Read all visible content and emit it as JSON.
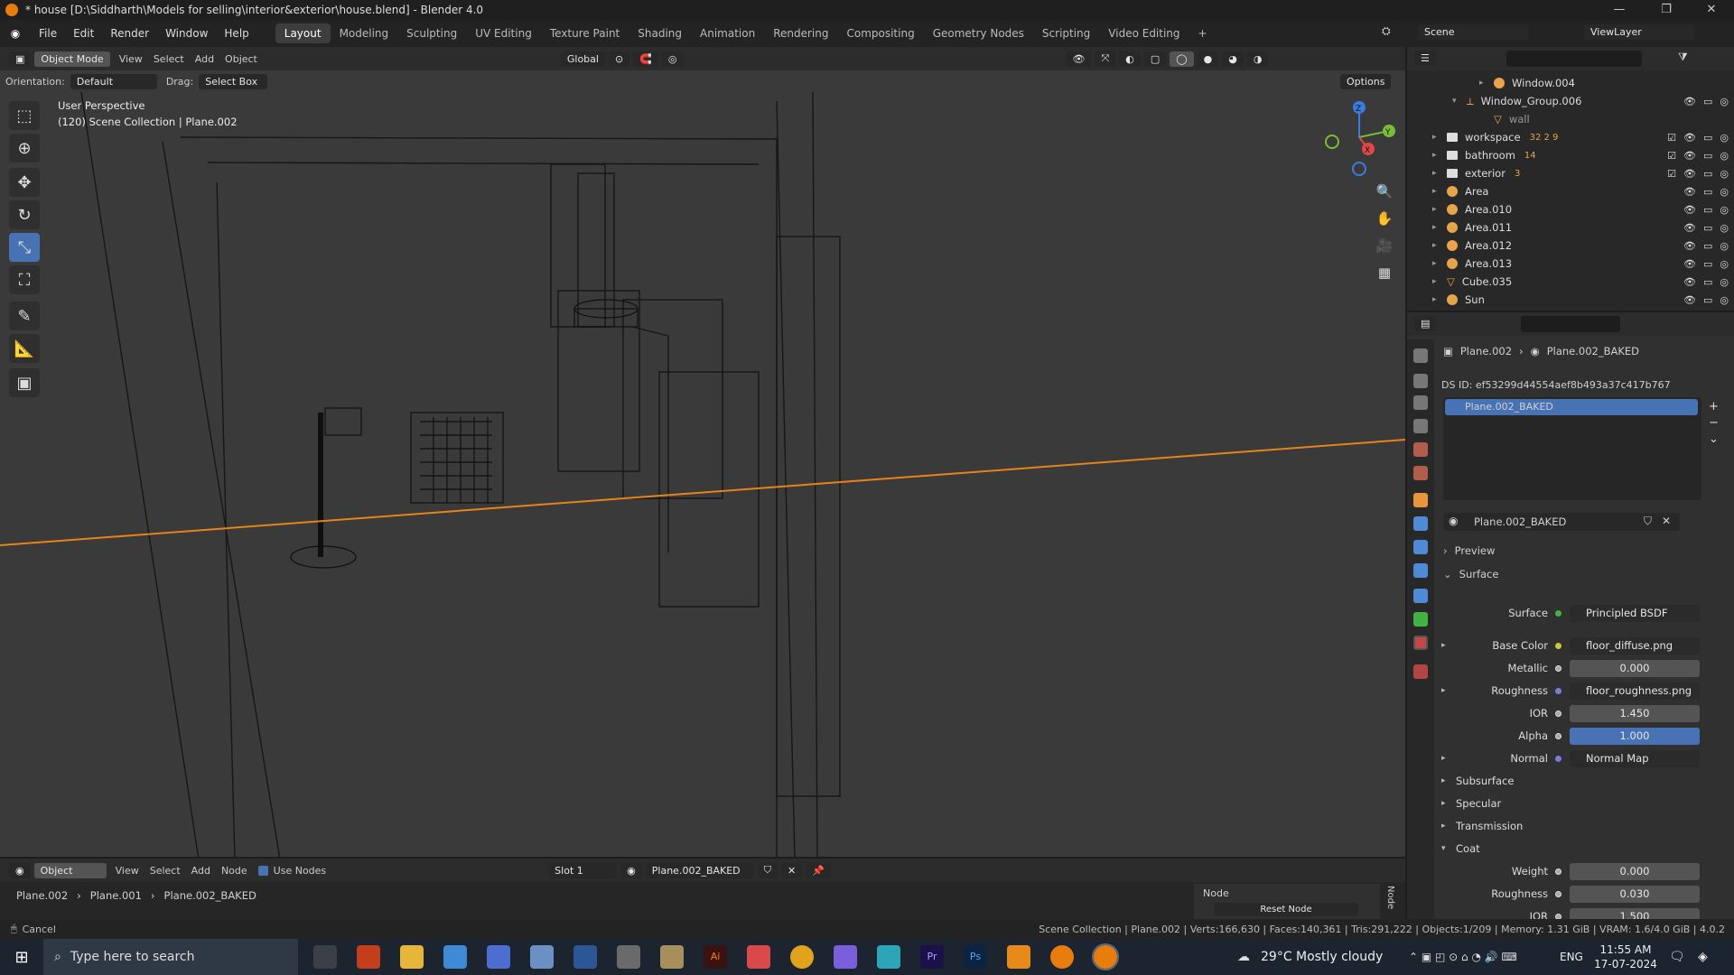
{
  "titlebar": {
    "text": "* house [D:\\Siddharth\\Models for selling\\interior&exterior\\house.blend] - Blender 4.0"
  },
  "menu": [
    "File",
    "Edit",
    "Render",
    "Window",
    "Help"
  ],
  "workspaces": [
    "Layout",
    "Modeling",
    "Sculpting",
    "UV Editing",
    "Texture Paint",
    "Shading",
    "Animation",
    "Rendering",
    "Compositing",
    "Geometry Nodes",
    "Scripting",
    "Video Editing"
  ],
  "active_workspace": "Layout",
  "scene": {
    "label": "Scene",
    "view_layer": "ViewLayer"
  },
  "viewport": {
    "mode": "Object Mode",
    "menus": [
      "View",
      "Select",
      "Add",
      "Object"
    ],
    "transform": "Global",
    "orientation_label": "Orientation:",
    "orientation_value": "Default",
    "drag_label": "Drag:",
    "drag_value": "Select Box",
    "options": "Options",
    "info_line1": "User Perspective",
    "info_line2": "(120) Scene Collection | Plane.002",
    "gizmo": {
      "x": "X",
      "y": "Y",
      "z": "Z"
    }
  },
  "outliner": {
    "rows": [
      {
        "name": "Window.004",
        "kind": "object"
      },
      {
        "name": "Window_Group.006",
        "kind": "empty"
      },
      {
        "name": "wall",
        "kind": "mesh"
      },
      {
        "name": "workspace",
        "kind": "collection",
        "badge": "32 2 9"
      },
      {
        "name": "bathroom",
        "kind": "collection",
        "badge": "14"
      },
      {
        "name": "exterior",
        "kind": "collection",
        "badge": "3"
      },
      {
        "name": "Area",
        "kind": "light"
      },
      {
        "name": "Area.010",
        "kind": "light"
      },
      {
        "name": "Area.011",
        "kind": "light"
      },
      {
        "name": "Area.012",
        "kind": "light"
      },
      {
        "name": "Area.013",
        "kind": "light"
      },
      {
        "name": "Cube.035",
        "kind": "mesh"
      },
      {
        "name": "Sun",
        "kind": "light"
      }
    ]
  },
  "properties": {
    "breadcrumb_obj": "Plane.002",
    "breadcrumb_mat": "Plane.002_BAKED",
    "ds_id": "DS ID: ef53299d44554aef8b493a37c417b767",
    "slot_item": "Plane.002_BAKED",
    "material_name": "Plane.002_BAKED",
    "preview": "Preview",
    "surface_section": "Surface",
    "fields": [
      {
        "label": "Surface",
        "value": "Principled BSDF",
        "type": "node"
      },
      {
        "label": "Base Color",
        "value": "floor_diffuse.png",
        "type": "node"
      },
      {
        "label": "Metallic",
        "value": "0.000",
        "type": "num"
      },
      {
        "label": "Roughness",
        "value": "floor_roughness.png",
        "type": "node"
      },
      {
        "label": "IOR",
        "value": "1.450",
        "type": "num"
      },
      {
        "label": "Alpha",
        "value": "1.000",
        "type": "blue"
      },
      {
        "label": "Normal",
        "value": "Normal Map",
        "type": "node"
      }
    ],
    "subsections": [
      "Subsurface",
      "Specular",
      "Transmission",
      "Coat"
    ],
    "coat_fields": [
      {
        "label": "Weight",
        "value": "0.000"
      },
      {
        "label": "Roughness",
        "value": "0.030"
      },
      {
        "label": "IOR",
        "value": "1.500"
      }
    ]
  },
  "node_editor": {
    "type": "Object",
    "menus": [
      "View",
      "Select",
      "Add",
      "Node"
    ],
    "use_nodes": "Use Nodes",
    "slot": "Slot 1",
    "material": "Plane.002_BAKED",
    "crumbs": [
      "Plane.002",
      "Plane.001",
      "Plane.002_BAKED"
    ],
    "node_panel": "Node",
    "reset": "Reset Node",
    "side_tab": "Node"
  },
  "status": {
    "left": "Cancel",
    "right": "Scene Collection | Plane.002 | Verts:166,630 | Faces:140,361 | Tris:291,222 | Objects:1/209 | Memory: 1.31 GiB | VRAM: 1.6/4.0 GiB | 4.0.2"
  },
  "taskbar": {
    "search": "Type here to search",
    "weather": "29°C  Mostly cloudy",
    "lang": "ENG",
    "time": "11:55 AM",
    "date": "17-07-2024"
  }
}
